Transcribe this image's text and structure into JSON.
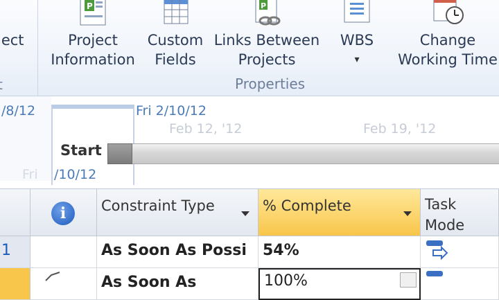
{
  "ribbon": {
    "left_partial": {
      "label_top": "ject",
      "label_bottom": "t"
    },
    "buttons": [
      {
        "id": "project-information",
        "line1": "Project",
        "line2": "Information"
      },
      {
        "id": "custom-fields",
        "line1": "Custom",
        "line2": "Fields"
      },
      {
        "id": "links-between-projects",
        "line1": "Links Between",
        "line2": "Projects"
      },
      {
        "id": "wbs",
        "line1": "WBS",
        "line2": "▾"
      },
      {
        "id": "change-working-time",
        "line1": "Change",
        "line2": "Working Time"
      }
    ],
    "group_label": "Properties"
  },
  "timeline": {
    "left_date": "/8/12",
    "current_date": "Fri 2/10/12",
    "ticks": [
      "Feb 12, '12",
      "Feb 19, '12"
    ],
    "start_label": "Start",
    "bottom_date_left": "Fri ",
    "bottom_date_right": "/10/12"
  },
  "grid": {
    "columns": [
      {
        "id": "indicators",
        "label": ""
      },
      {
        "id": "constraint-type",
        "label": "Constraint Type"
      },
      {
        "id": "percent-complete",
        "label": "% Complete"
      },
      {
        "id": "task-mode",
        "label_line1": "Task",
        "label_line2": "Mode"
      }
    ],
    "rows": [
      {
        "id": "1",
        "constraint": "As Soon As Possi",
        "percent": "54%",
        "bold": true
      },
      {
        "id": "",
        "constraint": "As Soon As",
        "percent": "100%",
        "bold": true
      }
    ]
  },
  "colors": {
    "accent_header": "#f8c64a",
    "timeline_date": "#4a7ab8",
    "info_icon": "#1d5bbf",
    "row_selected": "#f8c64a"
  }
}
